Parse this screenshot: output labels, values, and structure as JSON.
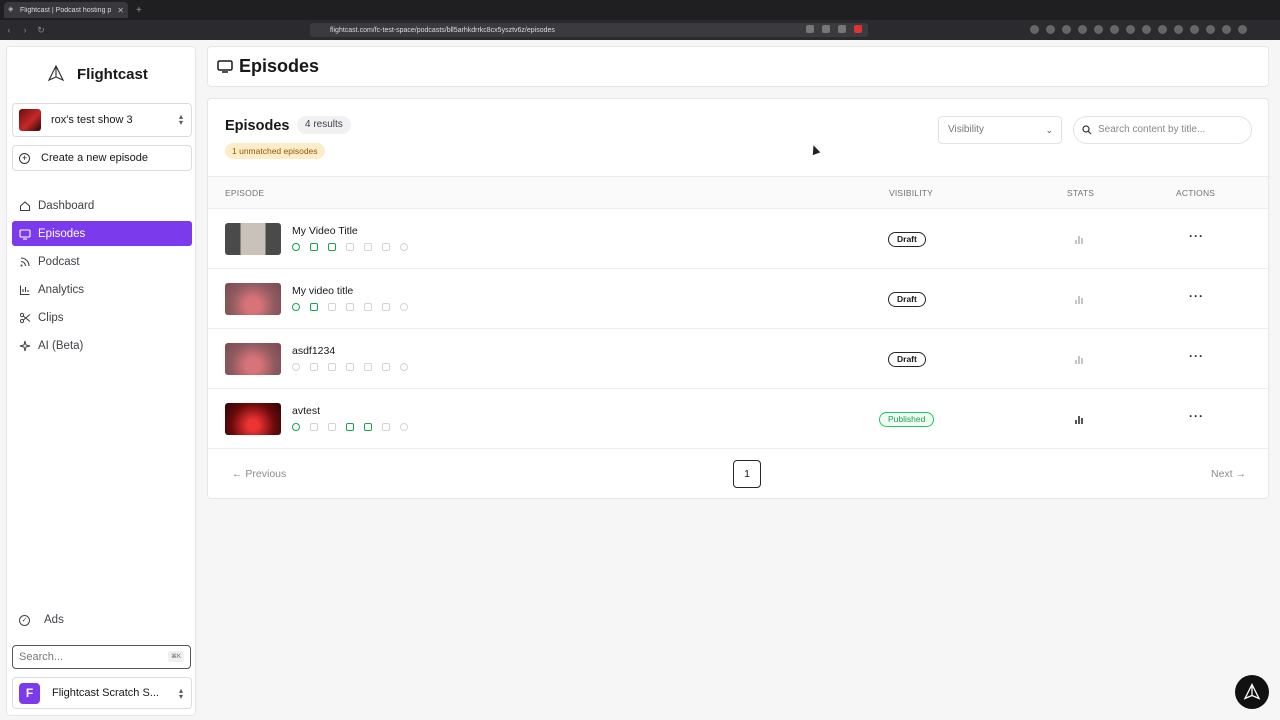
{
  "browser": {
    "tab_title": "Flightcast | Podcast hosting p",
    "url": "flightcast.com/fc-test-space/podcasts/bll5arhkdrrkc8cx5ysztv6z/episodes"
  },
  "sidebar": {
    "brand": "Flightcast",
    "show_name": "rox's test show 3",
    "create_label": "Create a new episode",
    "nav": [
      {
        "label": "Dashboard",
        "icon": "home-icon",
        "active": false
      },
      {
        "label": "Episodes",
        "icon": "tv-icon",
        "active": true
      },
      {
        "label": "Podcast",
        "icon": "rss-icon",
        "active": false
      },
      {
        "label": "Analytics",
        "icon": "bar-chart-icon",
        "active": false
      },
      {
        "label": "Clips",
        "icon": "scissors-icon",
        "active": false
      },
      {
        "label": "AI (Beta)",
        "icon": "sparkles-icon",
        "active": false
      }
    ],
    "ads_label": "Ads",
    "search_placeholder": "Search...",
    "search_shortcut": "⌘K",
    "workspace_initial": "F",
    "workspace_name": "Flightcast Scratch S..."
  },
  "header": {
    "title": "Episodes"
  },
  "episodes": {
    "title": "Episodes",
    "results": "4 results",
    "unmatched": "1 unmatched episodes",
    "visibility_placeholder": "Visibility",
    "search_placeholder": "Search content by title...",
    "columns": {
      "episode": "EPISODE",
      "visibility": "VISIBILITY",
      "stats": "STATS",
      "actions": "ACTIONS"
    },
    "rows": [
      {
        "title": "My Video Title",
        "status": "Draft",
        "platforms_on": [
          true,
          true,
          true,
          false,
          false,
          false,
          false
        ]
      },
      {
        "title": "My video title",
        "status": "Draft",
        "platforms_on": [
          true,
          true,
          false,
          false,
          false,
          false,
          false
        ]
      },
      {
        "title": "asdf1234",
        "status": "Draft",
        "platforms_on": [
          false,
          false,
          false,
          false,
          false,
          false,
          false
        ]
      },
      {
        "title": "avtest",
        "status": "Published",
        "platforms_on": [
          true,
          false,
          false,
          true,
          true,
          false,
          false
        ]
      }
    ],
    "pagination": {
      "previous": "← Previous",
      "page": "1",
      "next": "Next →"
    }
  },
  "colors": {
    "accent": "#7c3aed",
    "published": "#16a34a",
    "unmatched_bg": "#fdecc8"
  }
}
